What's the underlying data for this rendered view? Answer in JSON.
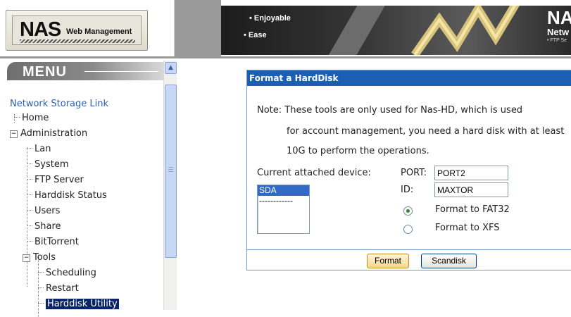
{
  "header": {
    "logo_main": "NAS",
    "logo_sub": "Web Management",
    "banner_bullets": [
      "• Enjoyable",
      "• Ease"
    ],
    "brand_big": "NA",
    "brand_line2": "Netw",
    "brand_line3": "• FTP Se"
  },
  "sidebar": {
    "menu_title": "MENU",
    "root_label": "Network Storage Link",
    "items": [
      {
        "label": "Home"
      },
      {
        "label": "Administration",
        "toggle": "⊟"
      },
      {
        "label": "Lan"
      },
      {
        "label": "System"
      },
      {
        "label": "FTP Server"
      },
      {
        "label": "Harddisk Status"
      },
      {
        "label": "Users"
      },
      {
        "label": "Share"
      },
      {
        "label": "BitTorrent"
      },
      {
        "label": "Tools",
        "toggle": "⊟"
      },
      {
        "label": "Scheduling"
      },
      {
        "label": "Restart"
      },
      {
        "label": "Harddisk Utility",
        "selected": true
      }
    ],
    "scroll_up_icon": "▲"
  },
  "panel": {
    "title": "Format a HardDisk",
    "note_line1": "Note: These tools are only used for Nas-HD, which is used",
    "note_line2": "for account management, you need a hard disk with at least",
    "note_line3": "10G to perform the operations.",
    "device_label": "Current attached device:",
    "devices": [
      "SDA",
      "------------"
    ],
    "port_label": "PORT:",
    "port_value": "PORT2",
    "id_label": "ID:",
    "id_value": "MAXTOR",
    "option_fat32": "Format to FAT32",
    "option_xfs": "Format to XFS",
    "selected_option": "FAT32",
    "format_button": "Format",
    "scandisk_button": "Scandisk"
  },
  "colors": {
    "panel_title_bg": "#1a5fb4",
    "selected_bg": "#0a246a",
    "link": "#3060b0"
  }
}
